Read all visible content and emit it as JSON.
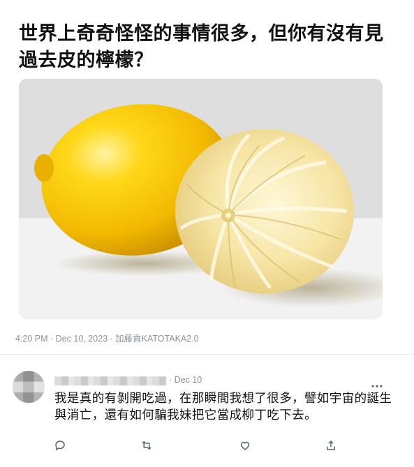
{
  "post": {
    "text": "世界上奇奇怪怪的事情很多，但你有沒有見過去皮的檸檬？",
    "image_alt_subject": "lemons"
  },
  "meta": {
    "time": "4:20 PM",
    "date": "Dec 10, 2023",
    "author": "加藤貢KATOTAKA2.0",
    "separator": " · "
  },
  "reply": {
    "date_prefix": "· ",
    "date": "Dec 10",
    "text": "我是真的有剝開吃過，在那瞬間我想了很多，譬如宇宙的誕生與消亡，還有如何騙我妹把它當成柳丁吃下去。"
  },
  "actions": [
    "comment-icon",
    "retweet-icon",
    "heart-icon",
    "share-icon"
  ],
  "colors": {
    "meta_gray": "#8a9299",
    "lemon_yellow": "#f4c400",
    "peeled_lemon": "#f3e3a0"
  }
}
